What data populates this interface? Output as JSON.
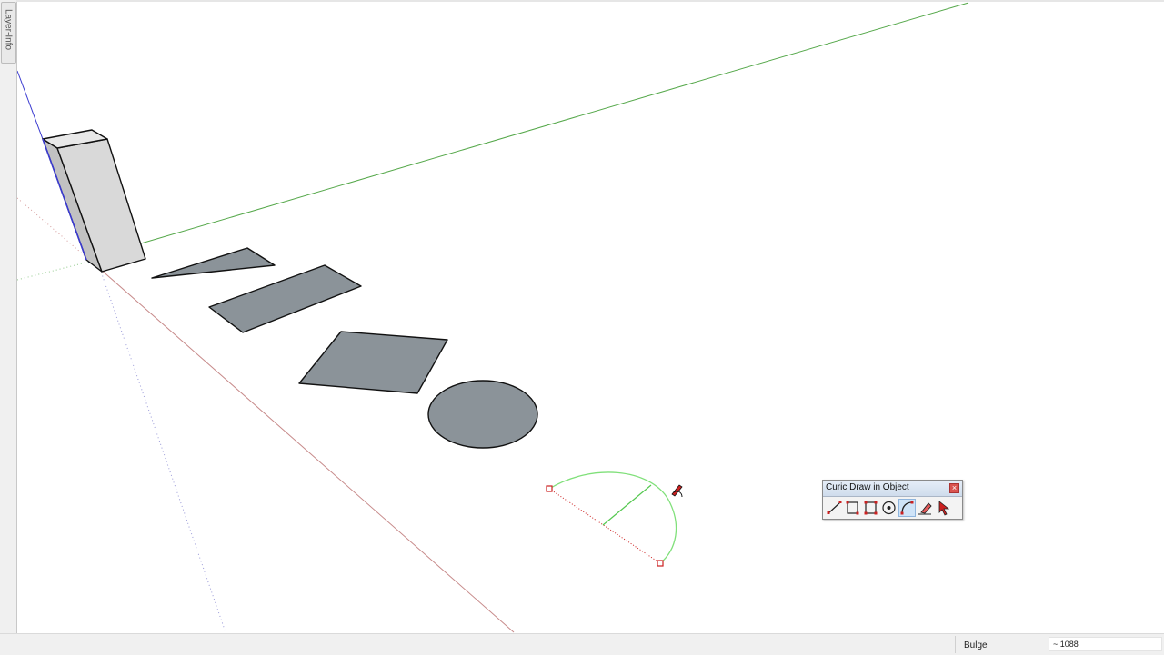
{
  "sidebar": {
    "tab_label": "Layer-Info"
  },
  "toolbar": {
    "title": "Curic Draw in Object",
    "close_glyph": "×",
    "tools": [
      {
        "name": "line-tool",
        "icon": "line-icon"
      },
      {
        "name": "rectangle-tool",
        "icon": "rectangle-icon"
      },
      {
        "name": "rotated-rectangle-tool",
        "icon": "rotated-rectangle-icon"
      },
      {
        "name": "circle-tool",
        "icon": "circle-icon"
      },
      {
        "name": "arc-tool",
        "icon": "arc-icon",
        "active": true
      },
      {
        "name": "eraser-tool",
        "icon": "eraser-icon"
      },
      {
        "name": "select-tool",
        "icon": "select-arrow-icon"
      }
    ]
  },
  "status": {
    "measure_label": "Bulge",
    "measure_value": "~ 1088"
  },
  "colors": {
    "face_fill": "#8b9399",
    "box_front": "#d9d9d9",
    "box_side": "#c2c2c2",
    "box_top": "#e8e8e8",
    "x_axis": "#c78a8a",
    "y_axis": "#55a84a",
    "z_axis": "#3a3ad0",
    "arc_preview": "#80e07a",
    "accent_red": "#cc2020"
  }
}
